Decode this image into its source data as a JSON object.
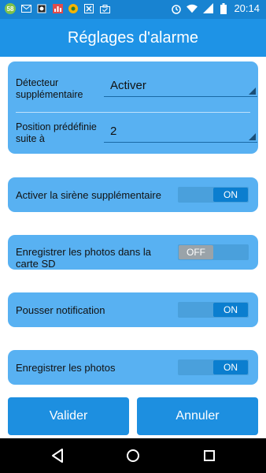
{
  "statusbar": {
    "badge": "58",
    "time": "20:14"
  },
  "app": {
    "title": "Réglages d'alarme"
  },
  "selects": [
    {
      "label": "Détecteur supplémentaire",
      "value": "Activer"
    },
    {
      "label": "Position prédéfinie suite à",
      "value": "2"
    }
  ],
  "toggles": [
    {
      "label": "Activer la sirène supplémentaire",
      "state": "ON"
    },
    {
      "label": "Enregistrer les photos dans la carte SD",
      "state": "OFF"
    },
    {
      "label": "Pousser notification",
      "state": "ON"
    },
    {
      "label": "Enregistrer les photos",
      "state": "ON"
    }
  ],
  "buttons": {
    "validate": "Valider",
    "cancel": "Annuler"
  },
  "colors": {
    "header": "#1e93e6",
    "card": "#58b1f2",
    "toggle_on": "#0b7ecf",
    "toggle_off": "#9aa3a9"
  },
  "icons": {
    "status": [
      "notification-badge",
      "email-icon",
      "app-icon",
      "chart-icon",
      "close-icon",
      "briefcase-icon",
      "alarm-icon",
      "wifi-icon",
      "signal-icon",
      "battery-icon"
    ],
    "nav": [
      "back-icon",
      "home-icon",
      "recents-icon"
    ]
  }
}
